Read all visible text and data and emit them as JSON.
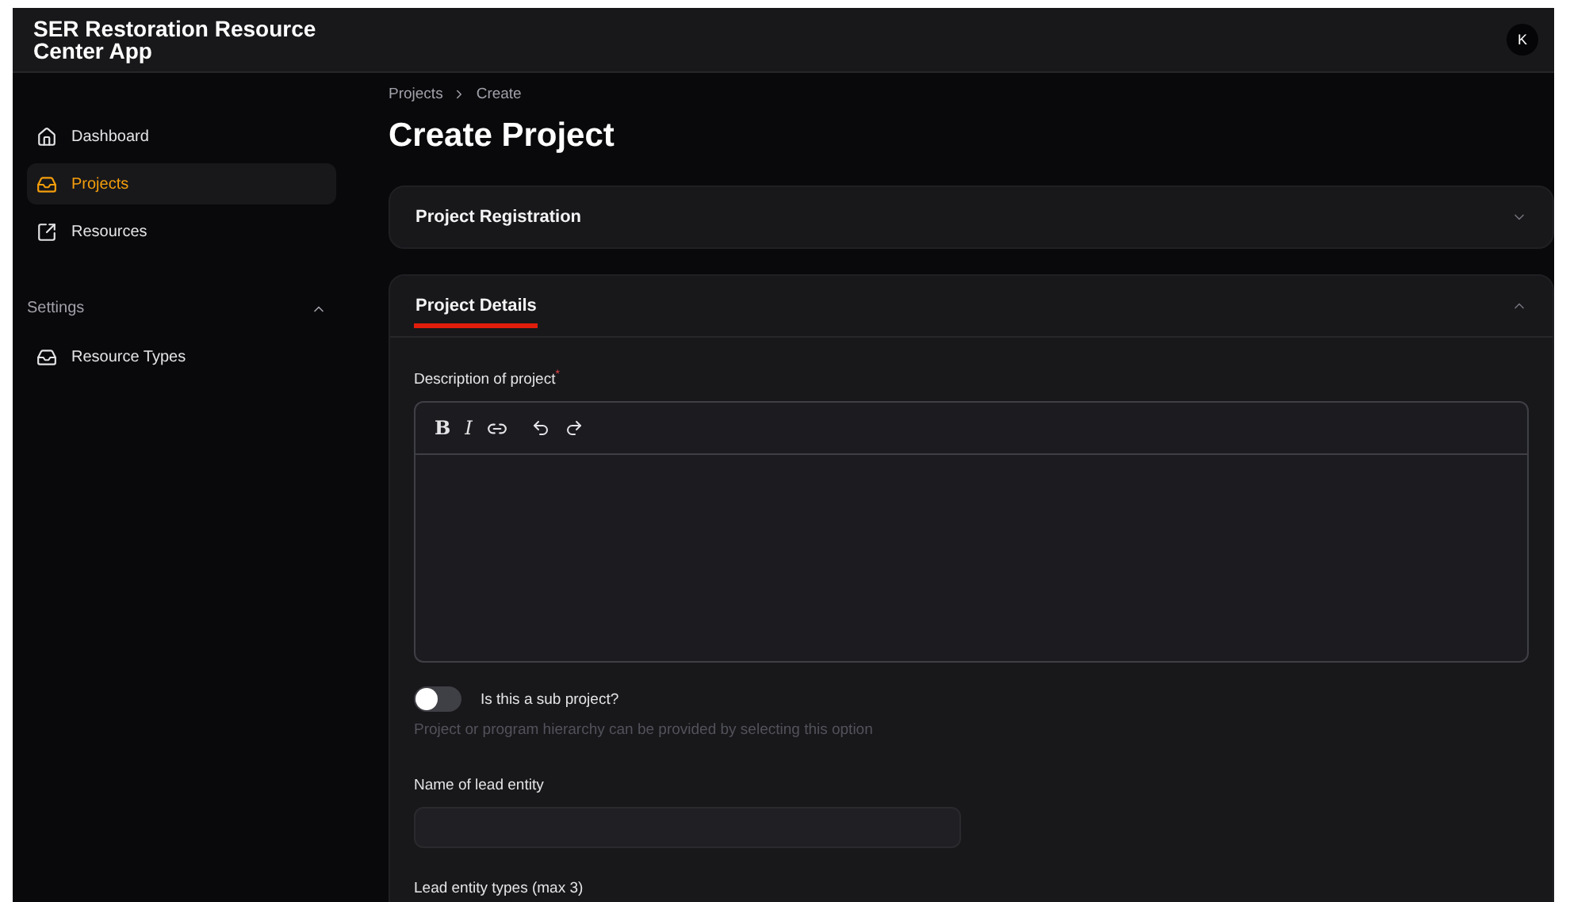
{
  "app": {
    "title": "SER Restoration Resource Center App",
    "avatar": "K"
  },
  "sidebar": {
    "items": [
      {
        "label": "Dashboard",
        "kind": "home",
        "selected": false
      },
      {
        "label": "Projects",
        "kind": "tray",
        "selected": true
      },
      {
        "label": "Resources",
        "kind": "external",
        "selected": false
      }
    ],
    "groups": [
      {
        "label": "Settings",
        "expanded": true,
        "items": [
          {
            "label": "Resource Types",
            "kind": "tray",
            "selected": false
          }
        ]
      }
    ]
  },
  "breadcrumb": [
    "Projects",
    "Create"
  ],
  "page_title": "Create Project",
  "sections": [
    {
      "title": "Project Registration",
      "expanded": false,
      "annotated": false
    },
    {
      "title": "Project Details",
      "expanded": true,
      "annotated": true
    }
  ],
  "form": {
    "description_label": "Description of project",
    "required_mark": "*",
    "toolbar": [
      {
        "kind": "bold",
        "label": "B"
      },
      {
        "kind": "italic",
        "label": "I"
      },
      {
        "kind": "link"
      },
      {
        "kind": "undo"
      },
      {
        "kind": "redo"
      }
    ],
    "sub_project": {
      "label": "Is this a sub project?",
      "on": false,
      "hint": "Project or program hierarchy can be provided by selecting this option"
    },
    "lead_entity_label": "Name of lead entity",
    "lead_entity_types_label": "Lead entity types (max 3)"
  }
}
